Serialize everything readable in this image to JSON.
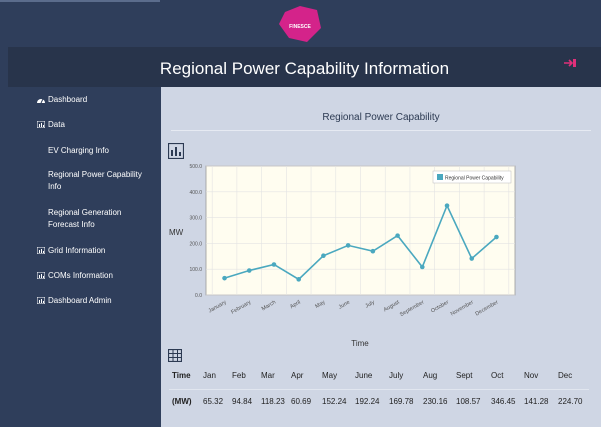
{
  "logo": {
    "text": "FINESCE",
    "color": "#d4238a"
  },
  "header": {
    "title": "Regional Power Capability Information",
    "icon": "logout-icon"
  },
  "sidebar": {
    "items": [
      {
        "label": "Dashboard",
        "icon": "dashboard-icon"
      },
      {
        "label": "Data",
        "icon": "bar-chart-icon"
      },
      {
        "label": "EV Charging Info",
        "sub": true
      },
      {
        "label": "Regional Power Capability Info",
        "sub": true
      },
      {
        "label": "Regional Generation Forecast Info",
        "sub": true
      },
      {
        "label": "Grid Information",
        "icon": "bar-chart-icon"
      },
      {
        "label": "COMs Information",
        "icon": "bar-chart-icon"
      },
      {
        "label": "Dashboard Admin",
        "icon": "bar-chart-icon"
      }
    ]
  },
  "panel": {
    "title": "Regional Power Capability",
    "chart_icon": "bar-chart-icon",
    "table_icon": "table-icon"
  },
  "chart_data": {
    "type": "line",
    "title": "",
    "xlabel": "Time",
    "ylabel": "MW",
    "categories": [
      "January",
      "February",
      "March",
      "April",
      "May",
      "June",
      "July",
      "August",
      "September",
      "October",
      "November",
      "December"
    ],
    "series": [
      {
        "name": "Regional Power Capability",
        "values": [
          65.32,
          94.84,
          118.23,
          60.69,
          152.24,
          192.24,
          169.78,
          230.16,
          108.57,
          346.45,
          141.28,
          224.7
        ]
      }
    ],
    "yticks": [
      "0.0",
      "100.0",
      "200.0",
      "300.0",
      "400.0",
      "500.0"
    ],
    "ylim": [
      0,
      500
    ],
    "grid": true,
    "legend": "top-right",
    "color": "#4aa8bf"
  },
  "table": {
    "header_label": "Time",
    "row_label": "(MW)",
    "months": [
      "Jan",
      "Feb",
      "Mar",
      "Apr",
      "May",
      "June",
      "July",
      "Aug",
      "Sept",
      "Oct",
      "Nov",
      "Dec"
    ],
    "values": [
      "65.32",
      "94.84",
      "118.23",
      "60.69",
      "152.24",
      "192.24",
      "169.78",
      "230.16",
      "108.57",
      "346.45",
      "141.28",
      "224.70"
    ]
  }
}
